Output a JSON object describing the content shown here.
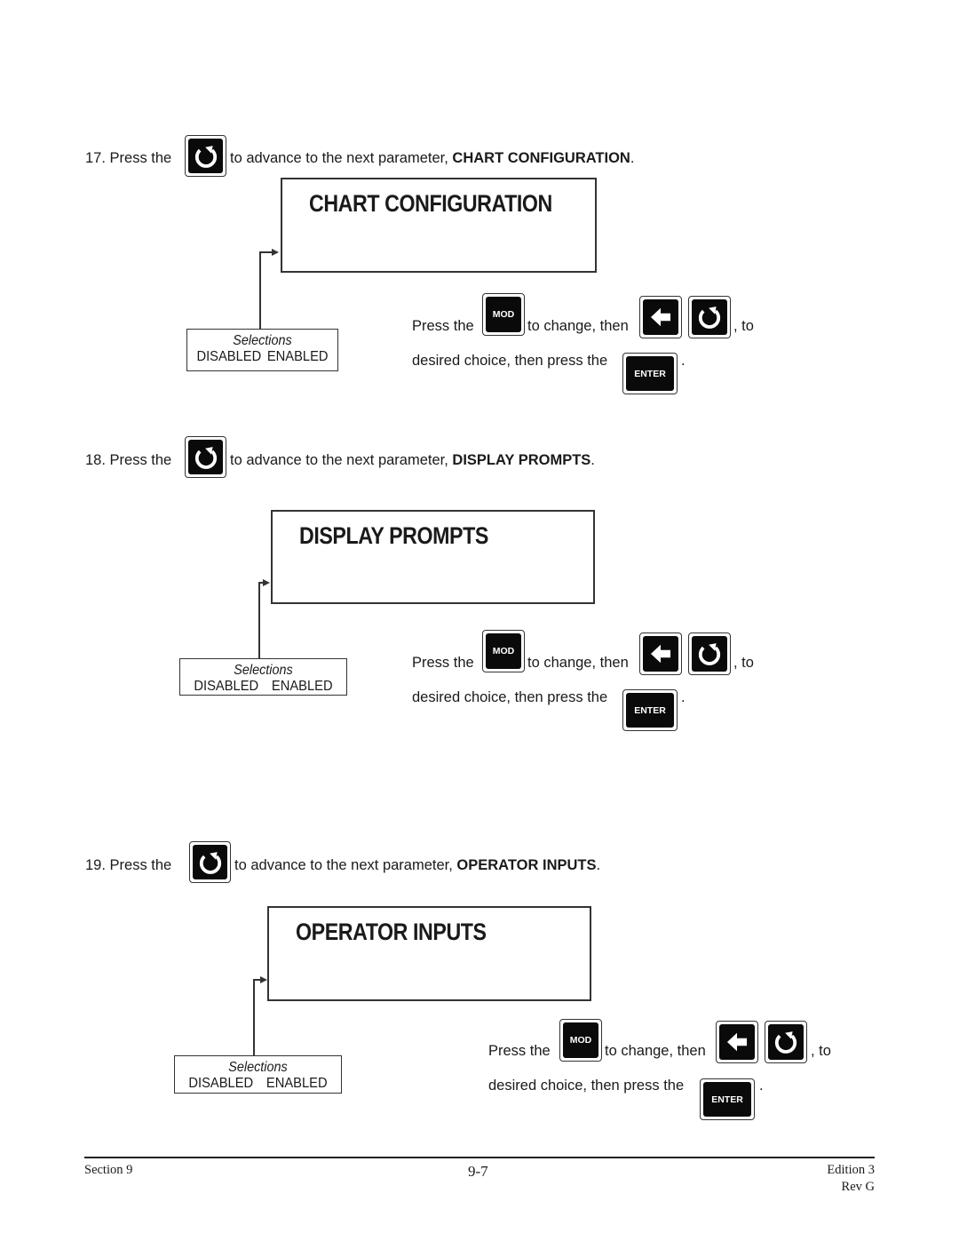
{
  "steps": [
    {
      "number": "17.",
      "press_the": "Press the",
      "advance_text": "to advance to the next parameter,",
      "parameter": "CHART CONFIGURATION",
      "period": ".",
      "screen_title": "CHART CONFIGURATION",
      "selections": {
        "header": "Selections",
        "options": [
          "DISABLED",
          "ENABLED"
        ]
      },
      "instruction": {
        "press_the": "Press the",
        "to_change_then": "to change, then",
        "comma_to": ", to",
        "desired_choice": "desired choice, then press the",
        "period": "."
      }
    },
    {
      "number": "18.",
      "press_the": "Press the",
      "advance_text": "to advance to the next parameter,",
      "parameter": "DISPLAY PROMPTS",
      "period": ".",
      "screen_title": "DISPLAY PROMPTS",
      "selections": {
        "header": "Selections",
        "options": [
          "DISABLED",
          "ENABLED"
        ]
      },
      "instruction": {
        "press_the": "Press the",
        "to_change_then": "to change, then",
        "comma_to": ", to",
        "desired_choice": "desired choice, then press the",
        "period": "."
      }
    },
    {
      "number": "19.",
      "press_the": "Press the",
      "advance_text": "to advance to the next parameter,",
      "parameter": "OPERATOR INPUTS",
      "period": ".",
      "screen_title": "OPERATOR INPUTS",
      "selections": {
        "header": "Selections",
        "options": [
          "DISABLED",
          "ENABLED"
        ]
      },
      "instruction": {
        "press_the": "Press the",
        "to_change_then": "to change, then",
        "comma_to": ", to",
        "desired_choice": "desired choice, then press the",
        "period": "."
      }
    }
  ],
  "keys": {
    "scroll": "scroll-key-icon",
    "mod_label": "MOD",
    "left_arrow": "left-arrow-key-icon",
    "enter_label": "ENTER"
  },
  "footer": {
    "section": "Section 9",
    "page": "9-7",
    "edition": "Edition 3",
    "revision": "Rev G"
  }
}
